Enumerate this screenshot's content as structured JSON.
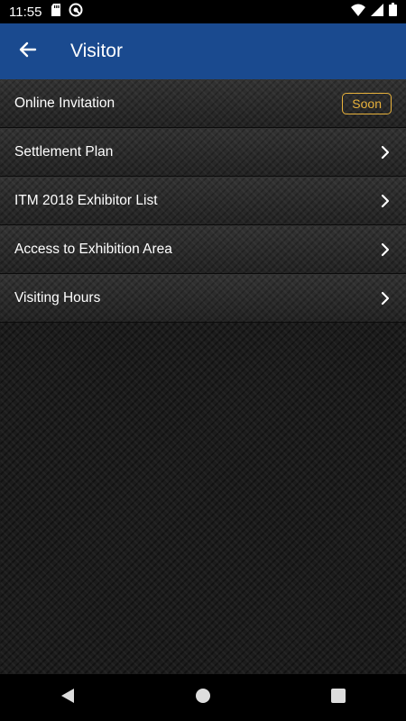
{
  "status_bar": {
    "time": "11:55",
    "icons": [
      "sd-card-icon",
      "vpn-icon",
      "wifi-icon",
      "signal-icon",
      "battery-icon"
    ]
  },
  "app_bar": {
    "back_icon": "arrow-back-icon",
    "title": "Visitor",
    "color": "#1a4a8f"
  },
  "menu": {
    "items": [
      {
        "label": "Online Invitation",
        "badge": "Soon"
      },
      {
        "label": "Settlement Plan",
        "icon": "chevron-right-icon"
      },
      {
        "label": "ITM 2018 Exhibitor List",
        "icon": "chevron-right-icon"
      },
      {
        "label": "Access to Exhibition Area",
        "icon": "chevron-right-icon"
      },
      {
        "label": "Visiting Hours",
        "icon": "chevron-right-icon"
      }
    ],
    "badge_color": "#e8b23c"
  },
  "nav_bar": {
    "buttons": [
      "back-triangle-icon",
      "home-circle-icon",
      "recents-square-icon"
    ]
  }
}
